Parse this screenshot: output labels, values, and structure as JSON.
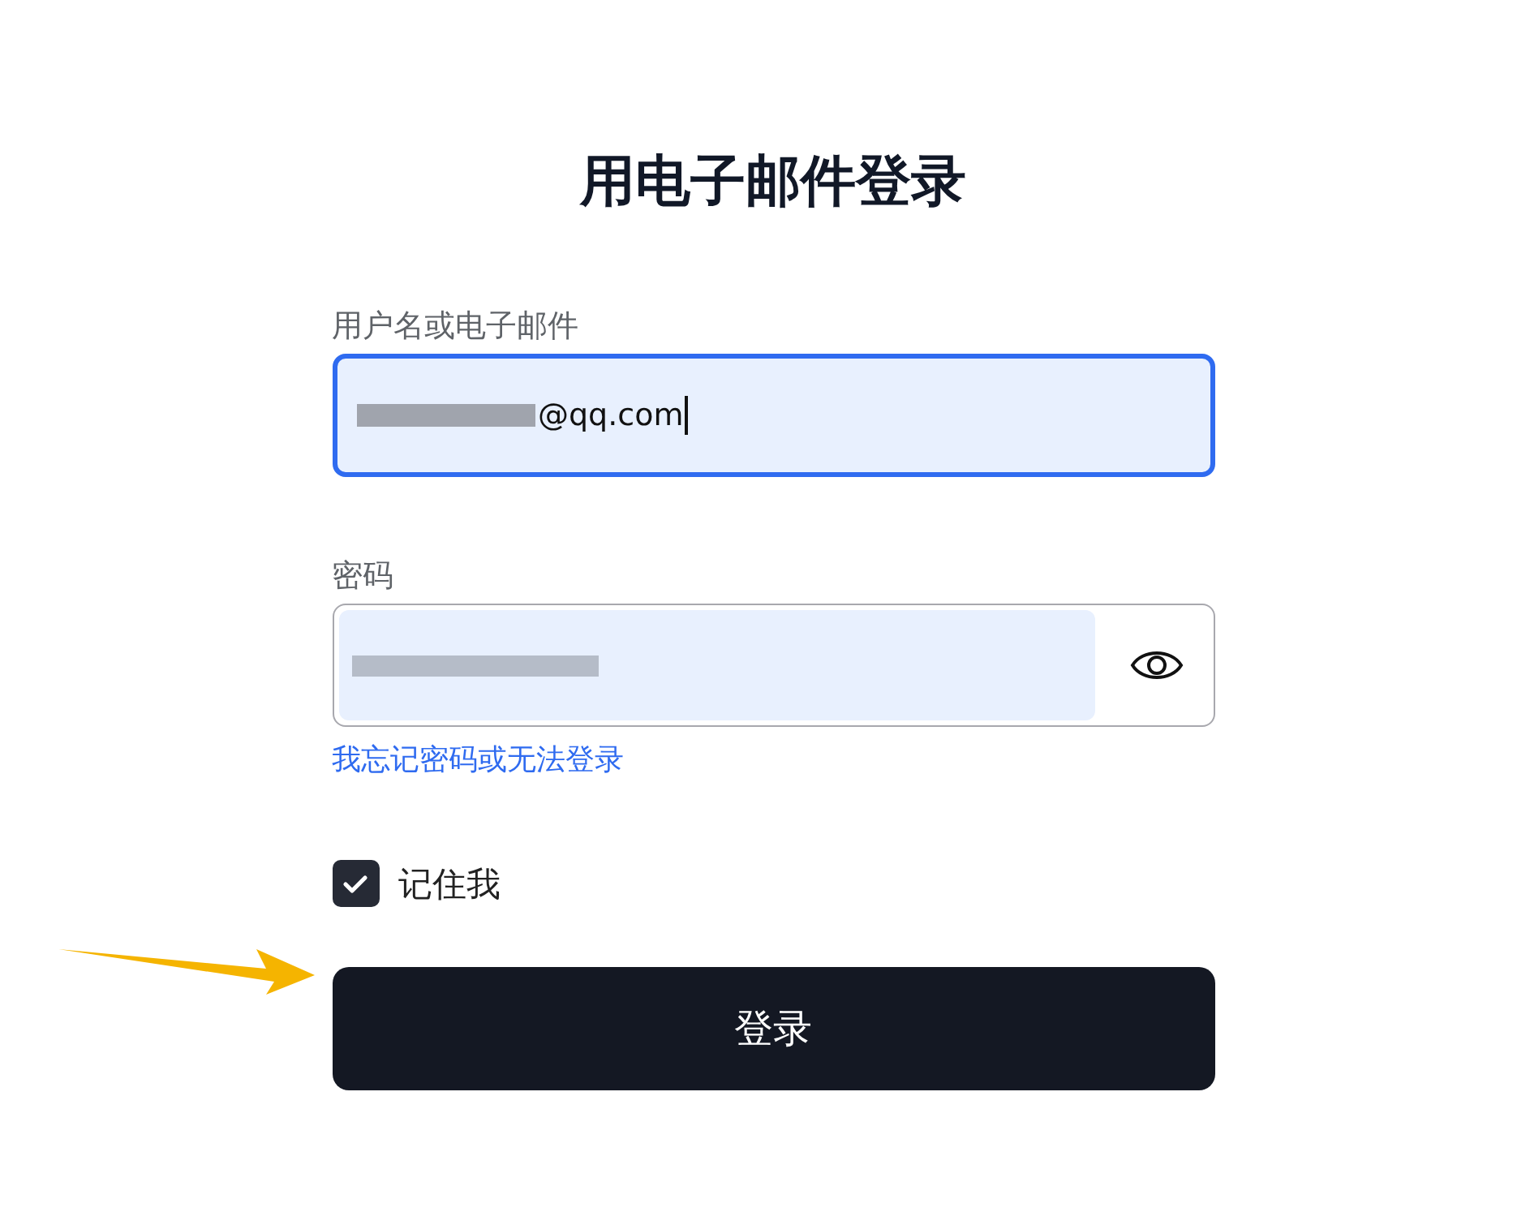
{
  "title": "用电子邮件登录",
  "username": {
    "label": "用户名或电子邮件",
    "value": "@qq.com",
    "focused": true,
    "redacted": true
  },
  "password": {
    "label": "密码",
    "redacted": true,
    "revealed": false
  },
  "forgot_link": "我忘记密码或无法登录",
  "remember": {
    "label": "记住我",
    "checked": true
  },
  "submit": "登录",
  "annotation_arrow": {
    "color": "#f5b400"
  }
}
